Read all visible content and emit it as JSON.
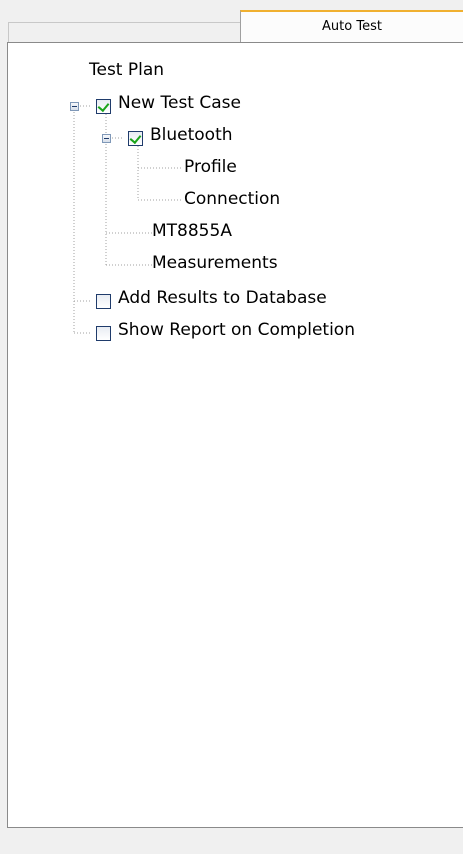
{
  "tabs": {
    "blank_label": "",
    "active_label": "Auto Test"
  },
  "tree": {
    "root_label": "Test Plan",
    "new_test_case": {
      "label": "New Test Case",
      "checked": true,
      "expanded": true
    },
    "bluetooth": {
      "label": "Bluetooth",
      "checked": true,
      "expanded": true
    },
    "profile": {
      "label": "Profile"
    },
    "connection": {
      "label": "Connection"
    },
    "mt8855a": {
      "label": "MT8855A"
    },
    "measurements": {
      "label": "Measurements"
    },
    "add_results": {
      "label": "Add Results to Database",
      "checked": false
    },
    "show_report": {
      "label": "Show Report on Completion",
      "checked": false
    }
  },
  "colors": {
    "tab_accent": "#f0b030",
    "check_green": "#1aa41a",
    "panel_border": "#8a8a8a"
  }
}
